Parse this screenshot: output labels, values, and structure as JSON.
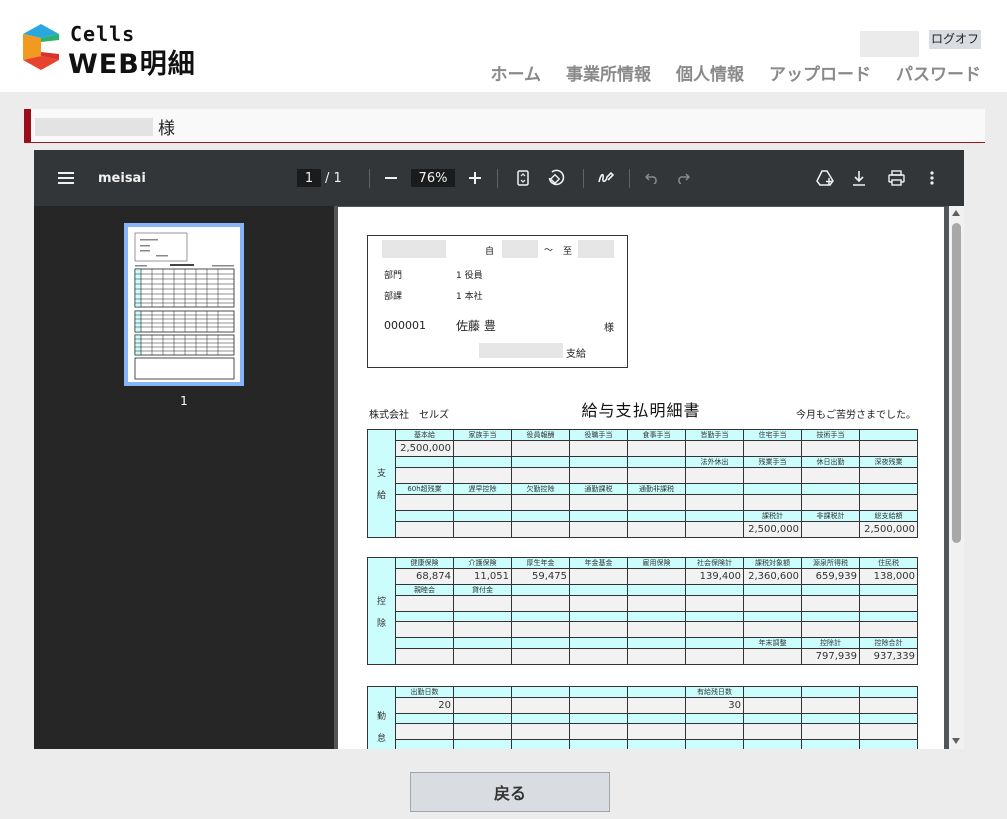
{
  "header": {
    "logo_cells": "Cells",
    "logo_web": "WEB明細",
    "logout": "ログオフ",
    "nav": [
      "ホーム",
      "事業所情報",
      "個人情報",
      "アップロード",
      "パスワード"
    ]
  },
  "name_bar": {
    "suffix": "様"
  },
  "viewer": {
    "title": "meisai",
    "page_current": "1",
    "page_total": "/ 1",
    "zoom": "76%",
    "thumb_label": "1",
    "icons": [
      "menu-icon",
      "zoom-out-icon",
      "zoom-in-icon",
      "fit-page-icon",
      "rotate-icon",
      "draw-icon",
      "undo-icon",
      "redo-icon",
      "drive-icon",
      "download-icon",
      "print-icon",
      "more-icon"
    ]
  },
  "payslip": {
    "from_label": "自",
    "tilde": "～",
    "to_label": "至",
    "dept_label": "部門",
    "dept_value": "1 役員",
    "section_label": "部課",
    "section_value": "1 本社",
    "emp_no": "000001",
    "emp_name": "佐藤 豊",
    "emp_suffix": "様",
    "pay_label": "支給",
    "company": "株式会社　セルズ",
    "title": "給与支払明細書",
    "thanks": "今月もご苦労さまでした。",
    "sections": [
      {
        "label": [
          "支",
          "給"
        ],
        "rows": [
          [
            "基本給",
            "家族手当",
            "役員報酬",
            "役職手当",
            "食事手当",
            "皆勤手当",
            "住宅手当",
            "技術手当",
            ""
          ],
          [
            "2,500,000",
            "",
            "",
            "",
            "",
            "",
            "",
            "",
            ""
          ],
          [
            "",
            "",
            "",
            "",
            "",
            "法外休出",
            "残業手当",
            "休日出勤",
            "深夜残業"
          ],
          [
            "",
            "",
            "",
            "",
            "",
            "",
            "",
            "",
            ""
          ],
          [
            "60h超残業",
            "遅早控除",
            "欠勤控除",
            "通勤課税",
            "通勤非課税",
            "",
            "",
            "",
            ""
          ],
          [
            "",
            "",
            "",
            "",
            "",
            "",
            "",
            "",
            ""
          ],
          [
            "",
            "",
            "",
            "",
            "",
            "",
            "課税計",
            "非課税計",
            "総支給額"
          ],
          [
            "",
            "",
            "",
            "",
            "",
            "",
            "2,500,000",
            "",
            "2,500,000"
          ]
        ]
      },
      {
        "label": [
          "控",
          "除"
        ],
        "rows": [
          [
            "健康保険",
            "介護保険",
            "厚生年金",
            "年金基金",
            "雇用保険",
            "社会保険計",
            "課税対象額",
            "源泉所得税",
            "住民税"
          ],
          [
            "68,874",
            "11,051",
            "59,475",
            "",
            "",
            "139,400",
            "2,360,600",
            "659,939",
            "138,000"
          ],
          [
            "親睦会",
            "貸付金",
            "",
            "",
            "",
            "",
            "",
            "",
            ""
          ],
          [
            "",
            "",
            "",
            "",
            "",
            "",
            "",
            "",
            ""
          ],
          [
            "",
            "",
            "",
            "",
            "",
            "",
            "",
            "",
            ""
          ],
          [
            "",
            "",
            "",
            "",
            "",
            "",
            "",
            "",
            ""
          ],
          [
            "",
            "",
            "",
            "",
            "",
            "",
            "年末調整",
            "控除計",
            "控除合計"
          ],
          [
            "",
            "",
            "",
            "",
            "",
            "",
            "",
            "797,939",
            "937,339"
          ]
        ]
      },
      {
        "label": [
          "勤",
          "怠"
        ],
        "rows": [
          [
            "出勤日数",
            "",
            "",
            "",
            "",
            "有給残日数",
            "",
            "",
            ""
          ],
          [
            "20",
            "",
            "",
            "",
            "",
            "30",
            "",
            "",
            ""
          ],
          [
            "",
            "",
            "",
            "",
            "",
            "",
            "",
            "",
            ""
          ],
          [
            "",
            "",
            "",
            "",
            "",
            "",
            "",
            "",
            ""
          ],
          [
            "",
            "",
            "",
            "",
            "",
            "",
            "",
            "",
            ""
          ],
          [
            "",
            "",
            "",
            "",
            "",
            "",
            "",
            "",
            ""
          ]
        ]
      }
    ]
  },
  "footer": {
    "back": "戻る"
  }
}
